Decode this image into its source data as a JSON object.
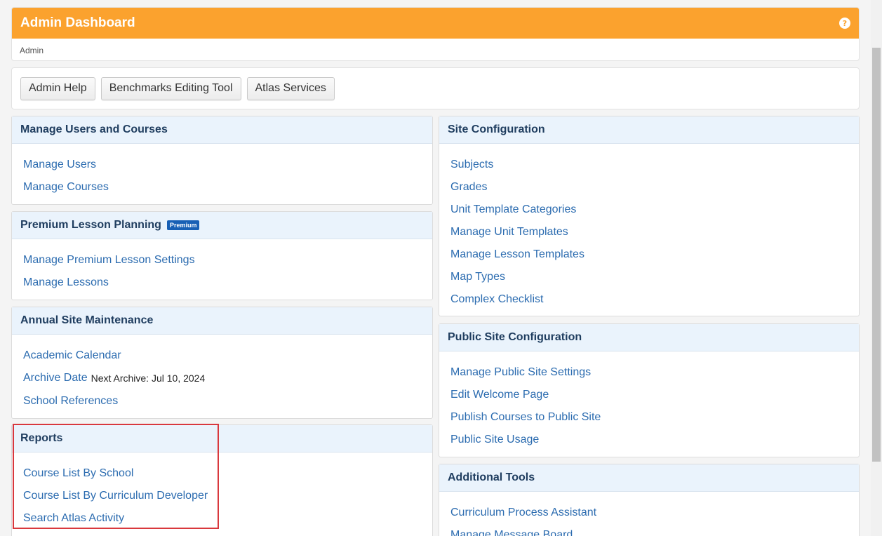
{
  "header": {
    "title": "Admin Dashboard",
    "help_icon": "?",
    "breadcrumb": "Admin",
    "accent_color": "#fba22e"
  },
  "toolbar": {
    "buttons": [
      "Admin Help",
      "Benchmarks Editing Tool",
      "Atlas Services"
    ]
  },
  "left": {
    "manage_users": {
      "title": "Manage Users and Courses",
      "links": [
        "Manage Users",
        "Manage Courses"
      ]
    },
    "premium": {
      "title": "Premium Lesson Planning",
      "badge": "Premium",
      "links": [
        "Manage Premium Lesson Settings",
        "Manage Lessons"
      ]
    },
    "annual": {
      "title": "Annual Site Maintenance",
      "links": [
        "Academic Calendar",
        "Archive Date",
        "School References"
      ],
      "archive_note": "Next Archive: Jul 10, 2024"
    },
    "reports": {
      "title": "Reports",
      "links": [
        "Course List By School",
        "Course List By Curriculum Developer",
        "Search Atlas Activity"
      ]
    }
  },
  "right": {
    "site_config": {
      "title": "Site Configuration",
      "links": [
        "Subjects",
        "Grades",
        "Unit Template Categories",
        "Manage Unit Templates",
        "Manage Lesson Templates",
        "Map Types",
        "Complex Checklist"
      ]
    },
    "public_config": {
      "title": "Public Site Configuration",
      "links": [
        "Manage Public Site Settings",
        "Edit Welcome Page",
        "Publish Courses to Public Site",
        "Public Site Usage"
      ]
    },
    "additional": {
      "title": "Additional Tools",
      "links": [
        "Curriculum Process Assistant",
        "Manage Message Board"
      ]
    }
  },
  "colors": {
    "link": "#2c6cb0",
    "panel_header_bg": "#eaf3fc",
    "highlight": "#d9383d"
  }
}
